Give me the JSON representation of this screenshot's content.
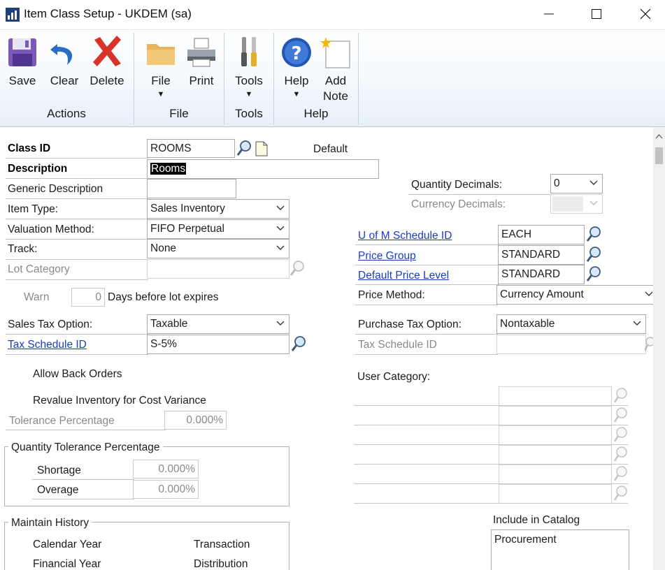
{
  "window": {
    "title": "Item Class Setup  -  UKDEM (sa)"
  },
  "ribbon": {
    "buttons": {
      "save": "Save",
      "clear": "Clear",
      "delete": "Delete",
      "file": "File",
      "print": "Print",
      "tools": "Tools",
      "help": "Help",
      "add_note_line1": "Add",
      "add_note_line2": "Note"
    },
    "groups": {
      "actions": "Actions",
      "file": "File",
      "tools": "Tools",
      "help": "Help"
    }
  },
  "form": {
    "class_id": {
      "label": "Class ID",
      "value": "ROOMS"
    },
    "default_label": "Default",
    "description": {
      "label": "Description",
      "value": "Rooms"
    },
    "generic_description": {
      "label": "Generic Description",
      "value": ""
    },
    "item_type": {
      "label": "Item Type:",
      "value": "Sales Inventory"
    },
    "valuation_method": {
      "label": "Valuation Method:",
      "value": "FIFO Perpetual"
    },
    "track": {
      "label": "Track:",
      "value": "None"
    },
    "lot_category": {
      "label": "Lot Category",
      "value": ""
    },
    "warn": {
      "label": "Warn",
      "value": "0",
      "suffix": "Days before lot expires"
    },
    "sales_tax_option": {
      "label": "Sales Tax Option:",
      "value": "Taxable"
    },
    "tax_schedule_id": {
      "label": "Tax Schedule ID",
      "value": "S-5%"
    },
    "allow_back_orders": "Allow Back Orders",
    "revalue_inventory": "Revalue Inventory for Cost Variance",
    "tolerance_percentage": {
      "label": "Tolerance Percentage",
      "value": "0.000%"
    },
    "quantity_tolerance": {
      "title": "Quantity Tolerance Percentage",
      "shortage_label": "Shortage",
      "shortage_value": "0.000%",
      "overage_label": "Overage",
      "overage_value": "0.000%"
    },
    "maintain_history": {
      "title": "Maintain History",
      "calendar_year": "Calendar Year",
      "financial_year": "Financial Year",
      "transaction": "Transaction",
      "distribution": "Distribution"
    },
    "quantity_decimals": {
      "label": "Quantity Decimals:",
      "value": "0"
    },
    "currency_decimals": {
      "label": "Currency Decimals:",
      "value": ""
    },
    "uofm_schedule_id": {
      "label": "U of M Schedule ID",
      "value": "EACH"
    },
    "price_group": {
      "label": "Price Group",
      "value": "STANDARD"
    },
    "default_price_level": {
      "label": "Default Price Level",
      "value": "STANDARD"
    },
    "price_method": {
      "label": "Price Method:",
      "value": "Currency Amount"
    },
    "purchase_tax_option": {
      "label": "Purchase Tax Option:",
      "value": "Nontaxable"
    },
    "purchase_tax_schedule_id": {
      "label": "Tax Schedule ID",
      "value": ""
    },
    "user_category": {
      "label": "User Category:"
    },
    "include_in_catalog": {
      "label": "Include in Catalog",
      "value": "Procurement"
    }
  }
}
